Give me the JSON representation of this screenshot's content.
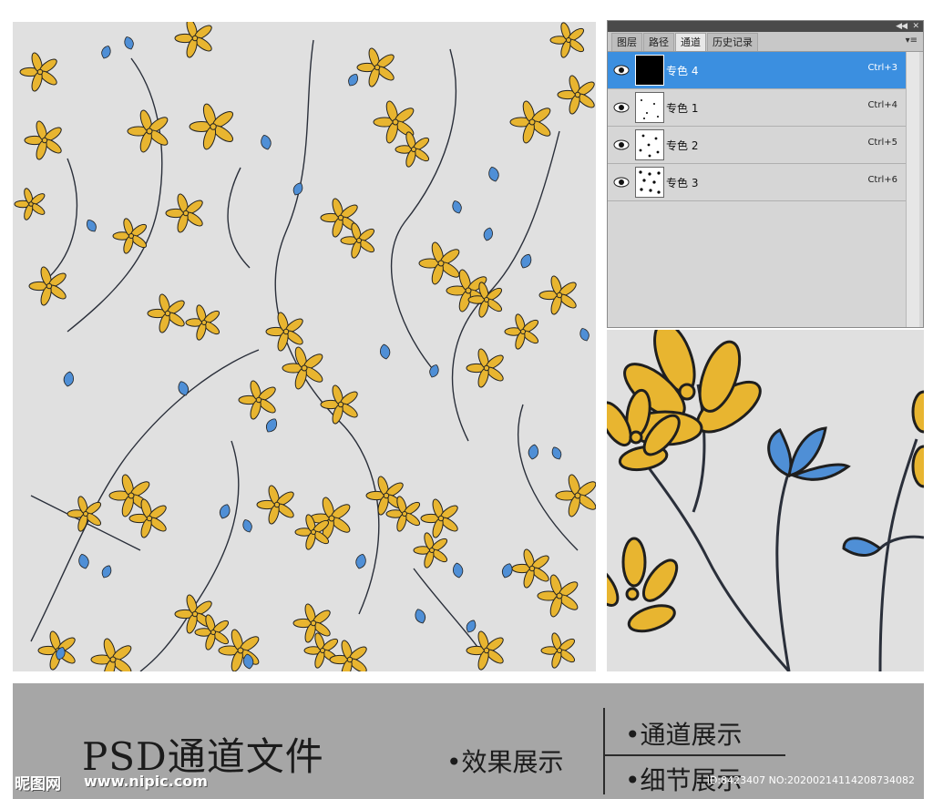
{
  "colors": {
    "background": "#e0e0e0",
    "flower_yellow": "#e8b530",
    "leaf_blue": "#4f8fd6",
    "stem": "#2a2f3a",
    "selected_row": "#3b8fe0",
    "footer_band": "#a6a6a6"
  },
  "pattern_image": {
    "name": "floral-pattern-preview"
  },
  "detail_image": {
    "name": "floral-detail-zoom"
  },
  "panel": {
    "tabs": [
      {
        "label": "图层",
        "active": false
      },
      {
        "label": "路径",
        "active": false
      },
      {
        "label": "通道",
        "active": true
      },
      {
        "label": "历史记录",
        "active": false
      }
    ],
    "channels": [
      {
        "name": "专色 4",
        "shortcut": "Ctrl+3",
        "selected": true,
        "visible_icon": "eye-icon"
      },
      {
        "name": "专色 1",
        "shortcut": "Ctrl+4",
        "selected": false,
        "visible_icon": "eye-icon"
      },
      {
        "name": "专色 2",
        "shortcut": "Ctrl+5",
        "selected": false,
        "visible_icon": "eye-icon"
      },
      {
        "name": "专色 3",
        "shortcut": "Ctrl+6",
        "selected": false,
        "visible_icon": "eye-icon"
      }
    ]
  },
  "footer": {
    "title": "PSD通道文件",
    "effect_label": "•效果展示",
    "channel_label": "•通道展示",
    "detail_label": "•细节展示",
    "logo": "昵图网",
    "url": "www.nipic.com",
    "id_text": "ID:8423407 NO:20200214114208734082"
  }
}
